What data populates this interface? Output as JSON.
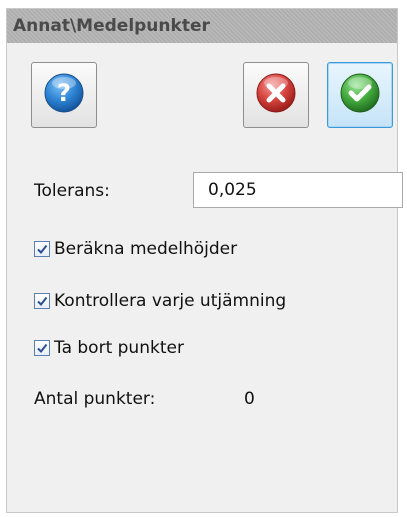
{
  "panel": {
    "title": "Annat\\Medelpunkter"
  },
  "toolbar": {
    "help_icon": "help-question-icon",
    "cancel_icon": "cancel-x-icon",
    "ok_icon": "ok-check-icon",
    "colors": {
      "help": "#1f6fbf",
      "cancel": "#c9302c",
      "ok": "#3fa33a",
      "active_border": "#3c9ad8"
    }
  },
  "form": {
    "tolerance_label": "Tolerans:",
    "tolerance_value": "0,025",
    "checkboxes": [
      {
        "label": "Beräkna medelhöjder",
        "checked": true
      },
      {
        "label": "Kontrollera varje utjämning",
        "checked": true
      },
      {
        "label": "Ta bort punkter",
        "checked": true
      }
    ],
    "count_label": "Antal punkter:",
    "count_value": "0"
  }
}
